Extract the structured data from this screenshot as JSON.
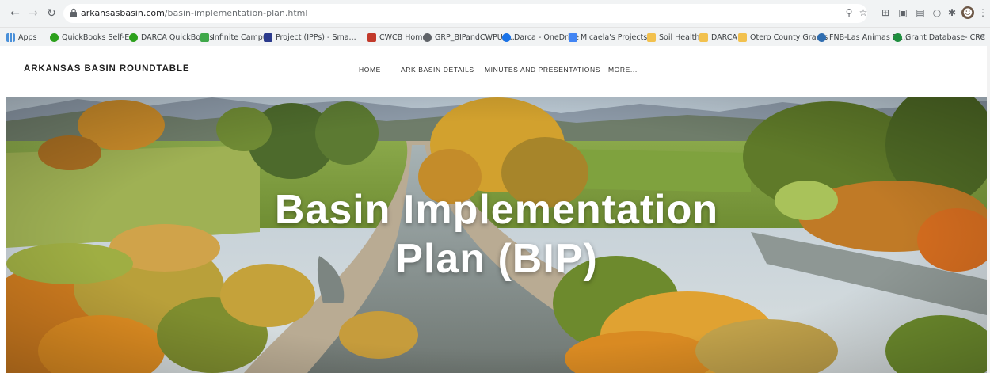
{
  "browser": {
    "url_host": "arkansasbasin.com",
    "url_path": "/basin-implementation-plan.html",
    "bookmarks": [
      {
        "label": "Apps",
        "color": "#4a90d9"
      },
      {
        "label": "QuickBooks Self-E...",
        "color": "#2ca01c"
      },
      {
        "label": "DARCA QuickBooks",
        "color": "#2ca01c"
      },
      {
        "label": "Infinite Campus",
        "color": "#3fa84a"
      },
      {
        "label": "Project (IPPs) - Sma...",
        "color": "#2b3a8c"
      },
      {
        "label": "CWCB Home",
        "color": "#c23a2b"
      },
      {
        "label": "GRP_BIPandCWPUp...",
        "color": "#5f6368"
      },
      {
        "label": "Darca - OneDrive",
        "color": "#1a73e8"
      },
      {
        "label": "Micaela's Projects",
        "color": "#4285f4"
      },
      {
        "label": "Soil Health",
        "color": "#f2c14e"
      },
      {
        "label": "DARCA",
        "color": "#f2c14e"
      },
      {
        "label": "Otero County Grants",
        "color": "#f2c14e"
      },
      {
        "label": "FNB-Las Animas Fir...",
        "color": "#2f6db0"
      },
      {
        "label": "Grant Database- CRC",
        "color": "#1e8e3e"
      }
    ],
    "bookmarks_more": "»"
  },
  "site": {
    "title": "ARKANSAS BASIN ROUNDTABLE",
    "nav": [
      "HOME",
      "ARK BASIN DETAILS",
      "MINUTES AND PRESENTATIONS",
      "MORE..."
    ]
  },
  "hero": {
    "title_line1": "Basin Implementation",
    "title_line2": "Plan (BIP)"
  },
  "icons": {
    "back": "arrow-left-icon",
    "forward": "arrow-right-icon",
    "reload": "reload-icon",
    "lock": "lock-icon",
    "zoom": "magnifier-icon",
    "star": "star-icon",
    "menu": "three-dots-icon"
  }
}
